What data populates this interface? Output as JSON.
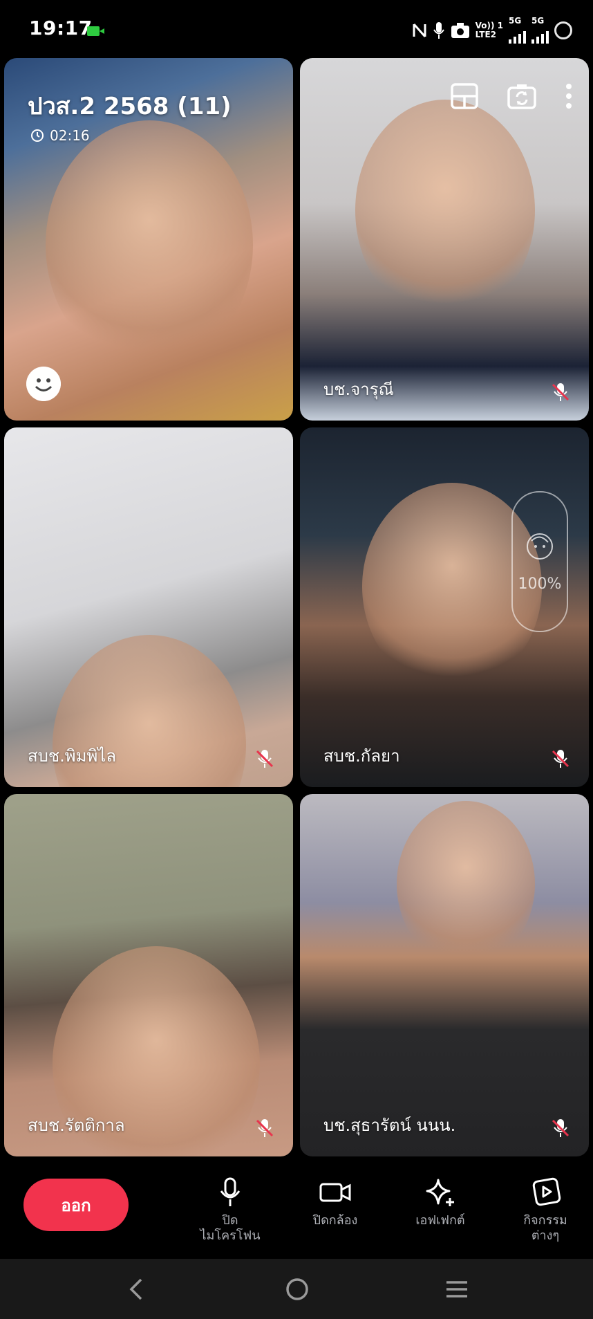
{
  "status_bar": {
    "time": "19:17",
    "network_left": "Vo)) 1",
    "network_left_sub": "LTE2",
    "network_5g_a": "5G",
    "network_5g_b": "5G"
  },
  "call": {
    "title": "ปวส.2 2568 (11)",
    "timer": "02:16"
  },
  "participants": [
    {
      "name": "",
      "muted": false
    },
    {
      "name": "บช.จารุณี",
      "muted": true
    },
    {
      "name": "สบช.พิมพิไล",
      "muted": true
    },
    {
      "name": "สบช.กัลยา",
      "muted": true
    },
    {
      "name": "สบช.รัตติกาล",
      "muted": true
    },
    {
      "name": "บช.สุธารัตน์ นนน.",
      "muted": true
    }
  ],
  "beauty_level": "100%",
  "toolbar": {
    "leave_label": "ออก",
    "mic_label": "ปิด\nไมโครโฟน",
    "camera_label": "ปิดกล้อง",
    "effects_label": "เอฟเฟกต์",
    "activities_label": "กิจกรรม\nต่างๆ"
  },
  "colors": {
    "leave_button": "#f2334d",
    "background": "#000000"
  },
  "icons": [
    "microphone-icon",
    "video-camera-icon",
    "sparkle-icon",
    "activities-icon",
    "layout-icon",
    "switch-camera-icon",
    "more-icon",
    "mic-off-icon",
    "clock-icon",
    "smiley-icon",
    "face-beauty-icon"
  ]
}
